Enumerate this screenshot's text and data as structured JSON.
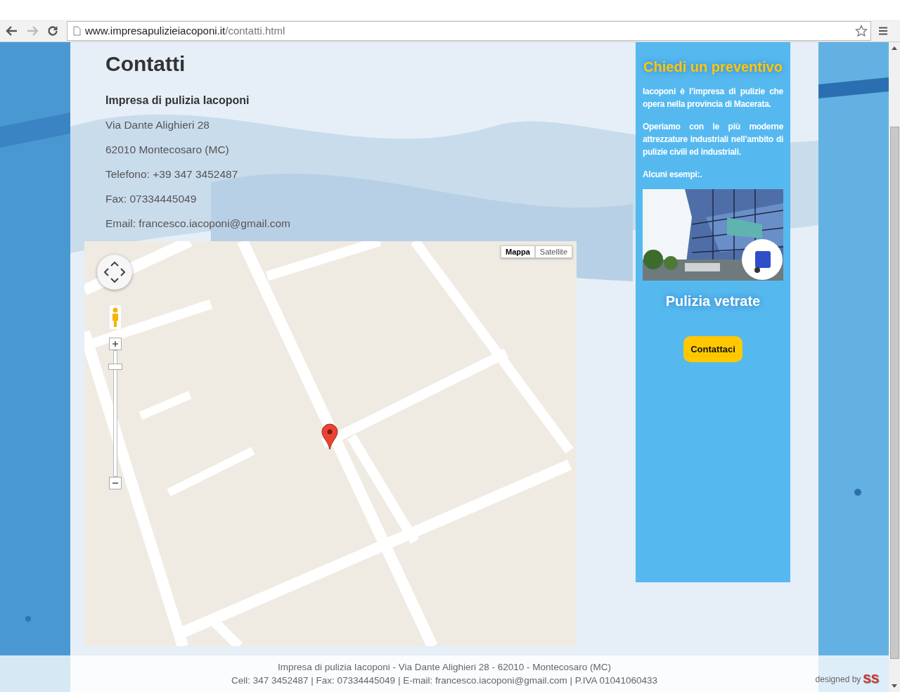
{
  "browser": {
    "url_host": "www.impresapulizieiacoponi.it",
    "url_path": "/contatti.html"
  },
  "contact": {
    "title": "Contatti",
    "company": "Impresa di pulizia Iacoponi",
    "lines": [
      "Via Dante Alighieri 28",
      "62010 Montecosaro (MC)",
      "Telefono: +39 347 3452487",
      "Fax: 07334445049",
      "Email: francesco.iacoponi@gmail.com"
    ]
  },
  "map": {
    "kind": "picture",
    "zoom": {
      "level": 0.9
    },
    "map_types": [
      {
        "label": "Mappa",
        "selected": true
      },
      {
        "label": "Satellite",
        "selected": false
      }
    ]
  },
  "sidebar": {
    "title": "Chiedi un preventivo",
    "paragraphs": [
      "Iacoponi è l’impresa di pulizie che opera nella provincia di Macerata.",
      "Operiamo con le più moderne attrezzature industriali nell’ambito di pulizie civili ed industriali.",
      "Alcuni esempi:."
    ],
    "example": {
      "kind": "picture",
      "caption": "Pulizia vetrate"
    },
    "button": "Contattaci"
  },
  "footer": {
    "lines": [
      "Impresa di pulizia Iacoponi - Via Dante Alighieri 28 - 62010 - Montecosaro (MC)",
      "Cell: 347 3452487 | Fax: 07334445049 | E-mail: francesco.iacoponi@gmail.com | P.IVA 01041060433"
    ],
    "credit": "designed by",
    "logo": "SS"
  }
}
